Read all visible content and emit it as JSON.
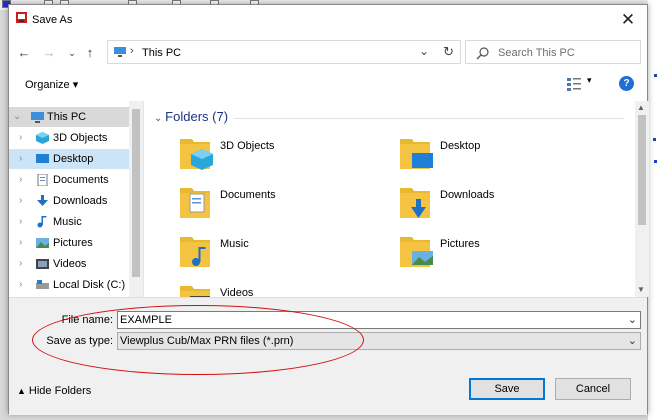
{
  "dialog": {
    "title": "Save As"
  },
  "address": {
    "crumb": "This PC"
  },
  "search": {
    "placeholder": "Search This PC"
  },
  "toolbar": {
    "organize_label": "Organize ▾"
  },
  "nav": {
    "items": [
      {
        "label": "This PC",
        "icon": "this-pc-icon"
      },
      {
        "label": "3D Objects",
        "icon": "3d-objects-icon"
      },
      {
        "label": "Desktop",
        "icon": "desktop-icon"
      },
      {
        "label": "Documents",
        "icon": "documents-icon"
      },
      {
        "label": "Downloads",
        "icon": "downloads-icon"
      },
      {
        "label": "Music",
        "icon": "music-icon"
      },
      {
        "label": "Pictures",
        "icon": "pictures-icon"
      },
      {
        "label": "Videos",
        "icon": "videos-icon"
      },
      {
        "label": "Local Disk (C:)",
        "icon": "local-disk-icon"
      }
    ]
  },
  "content": {
    "group_header": "Folders (7)",
    "folders": [
      {
        "label": "3D Objects",
        "icon": "3d-objects-folder-icon"
      },
      {
        "label": "Desktop",
        "icon": "desktop-folder-icon"
      },
      {
        "label": "Documents",
        "icon": "documents-folder-icon"
      },
      {
        "label": "Downloads",
        "icon": "downloads-folder-icon"
      },
      {
        "label": "Music",
        "icon": "music-folder-icon"
      },
      {
        "label": "Pictures",
        "icon": "pictures-folder-icon"
      },
      {
        "label": "Videos",
        "icon": "videos-folder-icon"
      }
    ]
  },
  "fields": {
    "file_name_label": "File name:",
    "file_name_value": "EXAMPLE",
    "save_type_label": "Save as type:",
    "save_type_value": "Viewplus Cub/Max PRN files (*.prn)"
  },
  "bottom": {
    "hide_folders_label": "Hide Folders",
    "save_label": "Save",
    "cancel_label": "Cancel"
  },
  "colors": {
    "selection": "#cce4f7",
    "accent": "#0078d7",
    "annotation": "#d01010",
    "folder": "#f5c342"
  }
}
